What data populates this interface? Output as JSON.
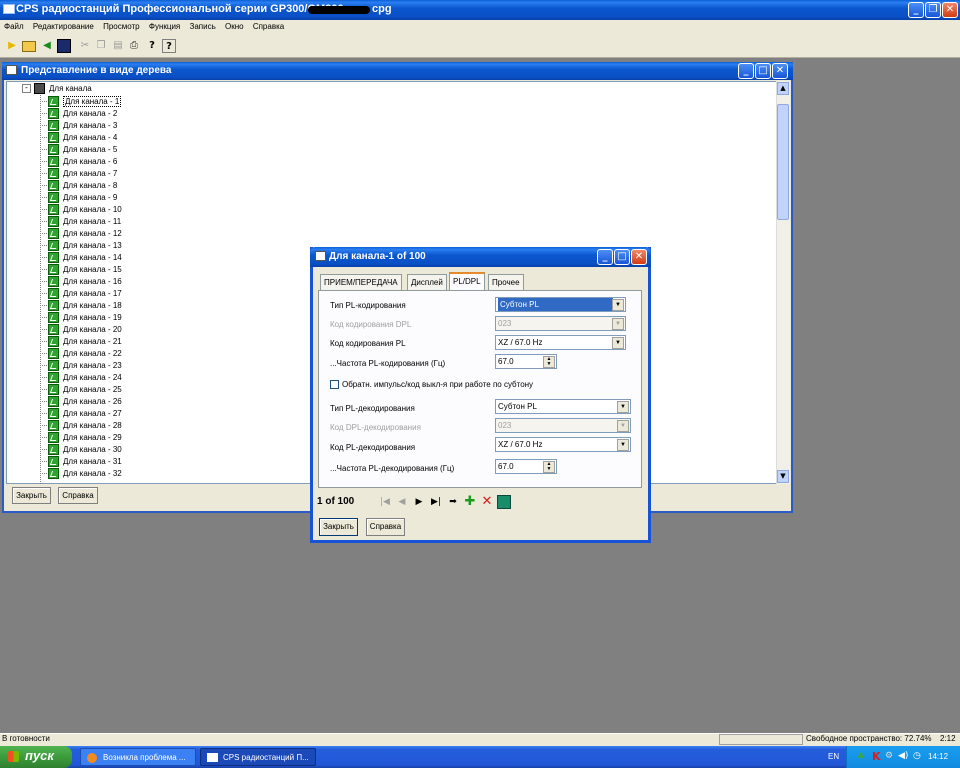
{
  "app": {
    "title": "CPS радиостанций Профессиональной серии GP300/GM300",
    "title_suffix": "cpg",
    "menu": [
      "Файл",
      "Редактирование",
      "Просмотр",
      "Функция",
      "Запись",
      "Окно",
      "Справка"
    ]
  },
  "toolbar": {
    "icons": [
      "open-wizard-icon",
      "open-folder-icon",
      "read-radio-icon",
      "save-icon",
      "cut-icon",
      "copy-icon",
      "paste-icon",
      "print-icon",
      "help-icon",
      "context-help-icon"
    ]
  },
  "tree_window": {
    "title": "Представление в виде дерева",
    "root_label": "Для канала",
    "items": [
      "Для канала - 1",
      "Для канала - 2",
      "Для канала - 3",
      "Для канала - 4",
      "Для канала - 5",
      "Для канала - 6",
      "Для канала - 7",
      "Для канала - 8",
      "Для канала - 9",
      "Для канала - 10",
      "Для канала - 11",
      "Для канала - 12",
      "Для канала - 13",
      "Для канала - 14",
      "Для канала - 15",
      "Для канала - 16",
      "Для канала - 17",
      "Для канала - 18",
      "Для канала - 19",
      "Для канала - 20",
      "Для канала - 21",
      "Для канала - 22",
      "Для канала - 23",
      "Для канала - 24",
      "Для канала - 25",
      "Для канала - 26",
      "Для канала - 27",
      "Для канала - 28",
      "Для канала - 29",
      "Для канала - 30",
      "Для канала - 31",
      "Для канала - 32"
    ],
    "selected_index": 0,
    "close_button": "Закрыть",
    "help_button": "Справка"
  },
  "dialog": {
    "title": "Для канала-1 of 100",
    "tabs": [
      "ПРИЕМ/ПЕРЕДАЧА",
      "Дисплей",
      "PL/DPL",
      "Прочее"
    ],
    "active_tab": 2,
    "fields": {
      "pl_encode_type": {
        "label": "Тип PL-кодирования",
        "value": "Субтон PL"
      },
      "dpl_encode_code": {
        "label": "Код кодирования DPL",
        "value": "023"
      },
      "pl_encode_code": {
        "label": "Код кодирования PL",
        "value": "XZ / 67.0 Hz"
      },
      "pl_encode_freq": {
        "label": "...Частота PL-кодирования (Гц)",
        "value": "67.0"
      },
      "reverse_burst": {
        "label": "Обратн. импульс/код выкл-я при работе по субтону",
        "checked": false
      },
      "pl_decode_type": {
        "label": "Тип PL-декодирования",
        "value": "Субтон PL"
      },
      "dpl_decode_code": {
        "label": "Код DPL-декодирования",
        "value": "023"
      },
      "pl_decode_code": {
        "label": "Код PL-декодирования",
        "value": "XZ / 67.0 Hz"
      },
      "pl_decode_freq": {
        "label": "...Частота PL-декодирования (Гц)",
        "value": "67.0"
      }
    },
    "record_position": "1 of 100",
    "close_button": "Закрыть",
    "help_button": "Справка"
  },
  "status": {
    "left": "В готовности",
    "free_space": "Свободное пространство: 72.74%",
    "time": "2:12"
  },
  "taskbar": {
    "start": "пуск",
    "tasks": [
      "Возникла проблема ...",
      "CPS радиостанций П..."
    ],
    "lang": "EN",
    "clock": "14:12"
  }
}
